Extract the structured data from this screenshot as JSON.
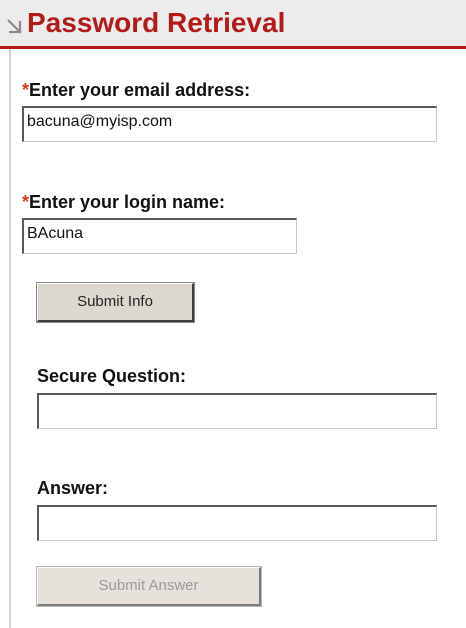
{
  "header": {
    "icon": "arrow-down-right-icon",
    "title": "Password Retrieval",
    "accent_color": "#b31b1b"
  },
  "form": {
    "required_marker": "*",
    "email": {
      "label": "Enter your email address:",
      "value": "bacuna@myisp.com"
    },
    "login": {
      "label": "Enter your login name:",
      "value": "BAcuna"
    },
    "submit_info_label": "Submit Info",
    "question": {
      "label": "Secure Question:",
      "value": ""
    },
    "answer": {
      "label": "Answer:",
      "value": ""
    },
    "submit_answer_label": "Submit Answer",
    "submit_answer_enabled": false
  }
}
